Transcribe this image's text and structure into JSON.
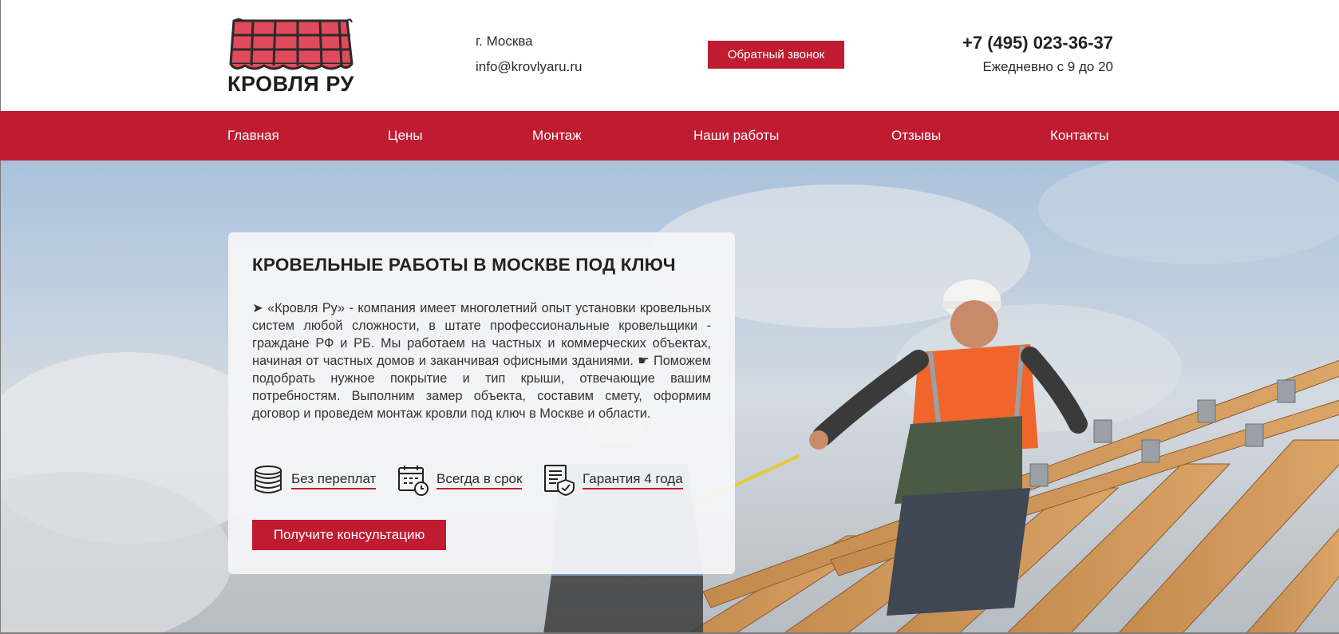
{
  "header": {
    "logo_text": "КРОВЛЯ РУ",
    "city": "г. Москва",
    "email": "info@krovlyaru.ru",
    "callback_label": "Обратный звонок",
    "phone": "+7 (495) 023-36-37",
    "hours": "Ежедневно с 9 до 20"
  },
  "nav": {
    "items": [
      {
        "label": "Главная"
      },
      {
        "label": "Цены"
      },
      {
        "label": "Монтаж"
      },
      {
        "label": "Наши работы"
      },
      {
        "label": "Отзывы"
      },
      {
        "label": "Контакты"
      }
    ]
  },
  "hero": {
    "title": "КРОВЕЛЬНЫЕ РАБОТЫ В МОСКВЕ ПОД КЛЮЧ",
    "text": "➤ «Кровля Ру» - компания имеет многолетний опыт установки кровельных систем любой сложности, в штате профессиональные кровельщики - граждане РФ и РБ. Мы работаем на частных и коммерческих объектах, начиная от частных домов и заканчивая офисными зданиями. ☛ Поможем подобрать нужное покрытие и тип крыши, отвечающие вашим потребностям. Выполним замер объекта, составим смету, оформим договор и проведем монтаж кровли под ключ в Москве и области.",
    "features": [
      {
        "label": "Без переплат",
        "icon": "coins-icon"
      },
      {
        "label": "Всегда в срок",
        "icon": "calendar-clock-icon"
      },
      {
        "label": "Гарантия 4 года",
        "icon": "document-shield-icon"
      }
    ],
    "consult_label": "Получите консультацию"
  },
  "colors": {
    "brand": "#c01c31",
    "text": "#2b2b2b"
  }
}
